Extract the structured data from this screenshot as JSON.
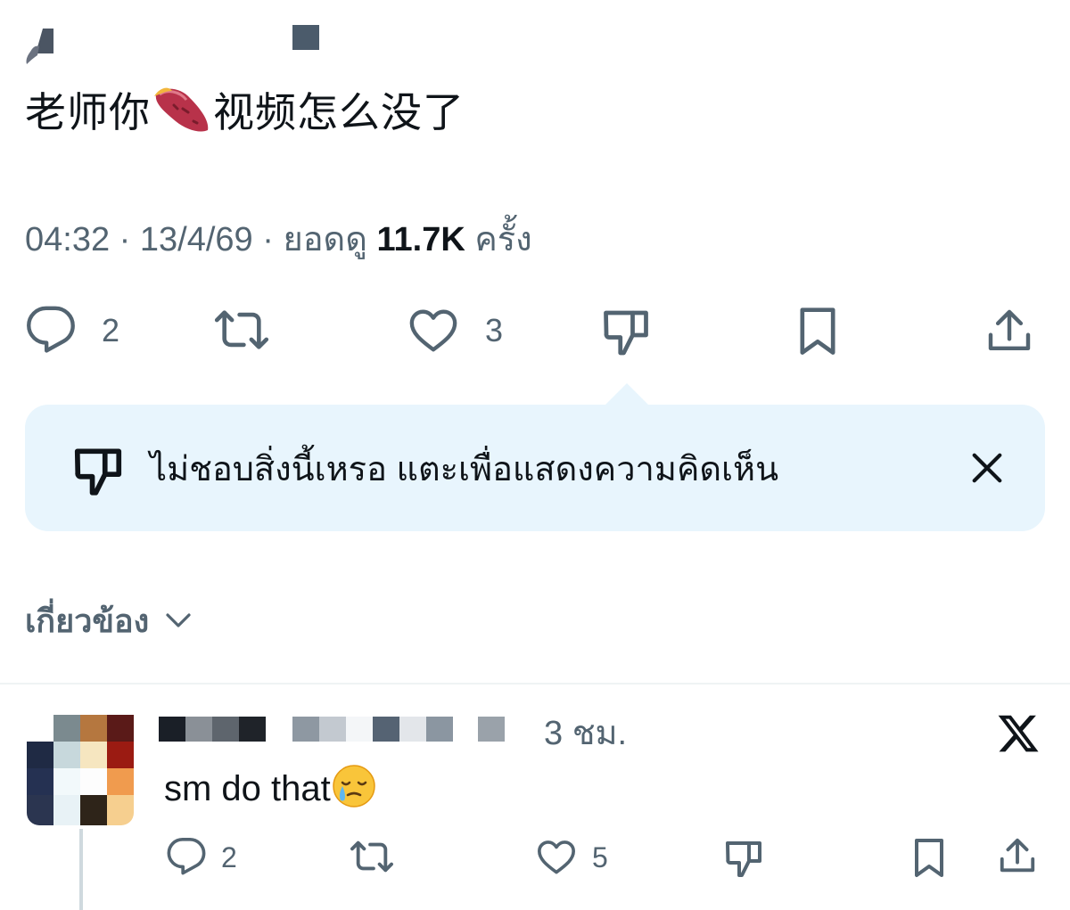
{
  "tweet": {
    "text_before": "老师你",
    "emoji_name": "sweet-potato-emoji",
    "text_after": "视频怎么没了",
    "time": "04:32",
    "date": "13/4/69",
    "views_label": "ยอดดู",
    "views_count": "11.7K",
    "views_suffix": "ครั้ง",
    "separator": "·",
    "actions": {
      "reply_count": "2",
      "like_count": "3"
    }
  },
  "dislike_toast": {
    "message": "ไม่ชอบสิ่งนี้เหรอ แตะเพื่อแสดงความคิดเห็น"
  },
  "related": {
    "label": "เกี่ยวข้อง"
  },
  "reply": {
    "time": "3 ชม.",
    "text": "sm do that",
    "emoji_name": "face-holding-back-tears-emoji",
    "actions": {
      "reply_count": "2",
      "like_count": "5"
    }
  },
  "icons": {
    "reply": "reply-icon",
    "retweet": "retweet-icon",
    "like": "heart-icon",
    "dislike": "thumbs-down-icon",
    "bookmark": "bookmark-icon",
    "share": "share-icon",
    "close": "close-icon",
    "chevron": "chevron-down-icon",
    "brand": "x-logo-icon"
  },
  "colors": {
    "text_primary": "#0f1419",
    "text_secondary": "#536471",
    "toast_background": "#e8f5fd",
    "divider": "#eff3f4"
  }
}
